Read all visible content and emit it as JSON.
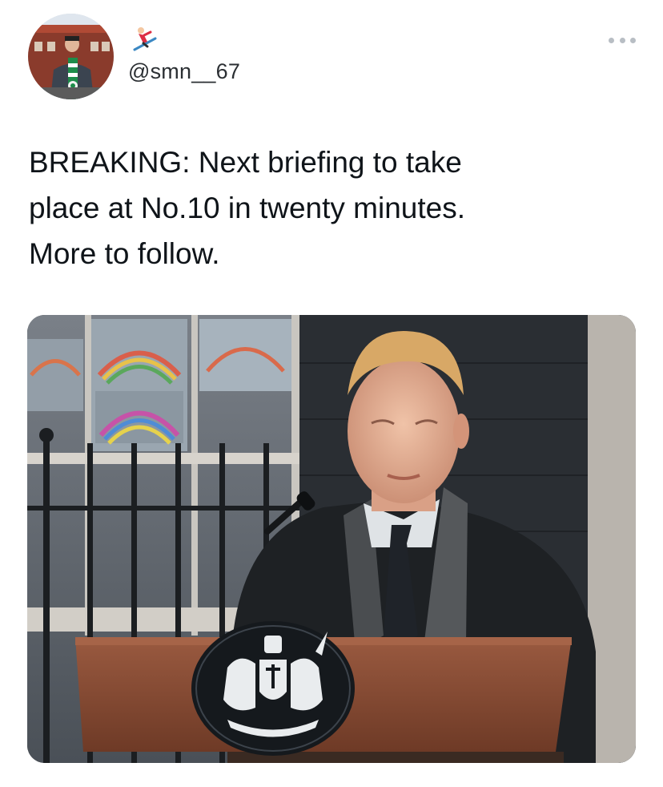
{
  "user": {
    "handle": "@smn__67",
    "avatar_icon": "profile-avatar-icon",
    "badge_emoji_icon": "skier-icon"
  },
  "tweet": {
    "text_lines": [
      "BREAKING: Next briefing to take",
      "place at No.10 in twenty minutes.",
      "More to follow."
    ]
  },
  "menu": {
    "more_icon": "more-options-icon"
  },
  "media": {
    "description_icon": "attached-photo",
    "podium_seal_icon": "royal-coat-of-arms-icon"
  },
  "colors": {
    "text": "#0f1419",
    "muted": "#b8bec4",
    "podium_wood": "#8b4b34"
  }
}
